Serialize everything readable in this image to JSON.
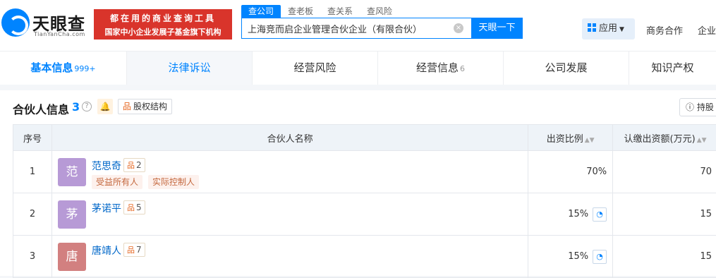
{
  "header": {
    "logo_text": "天眼查",
    "logo_sub": "TianYanCha.com",
    "promo_line1": "都在用的商业查询工具",
    "promo_line2": "国家中小企业发展子基金旗下机构",
    "search_tabs": [
      "查公司",
      "查老板",
      "查关系",
      "查风险"
    ],
    "search_value": "上海竞而启企业管理合伙企业（有限合伙）",
    "search_button": "天眼一下",
    "apps_label": "应用",
    "nav_links": [
      "商务合作",
      "企业"
    ]
  },
  "tabs": [
    {
      "label": "基本信息",
      "count": "999+"
    },
    {
      "label": "法律诉讼",
      "count": ""
    },
    {
      "label": "经营风险",
      "count": ""
    },
    {
      "label": "经营信息",
      "count": "6"
    },
    {
      "label": "公司发展",
      "count": ""
    },
    {
      "label": "知识产权",
      "count": ""
    }
  ],
  "section": {
    "title": "合伙人信息",
    "count": "3",
    "equity_label": "股权结构",
    "hold_label": "持股"
  },
  "table": {
    "headers": [
      "序号",
      "合伙人名称",
      "出资比例",
      "认缴出资额(万元)"
    ],
    "rows": [
      {
        "no": "1",
        "avatar": "范",
        "avatar_color": "#b79ad6",
        "name": "范思奇",
        "relations": "2",
        "tags": [
          "受益所有人",
          "实际控制人"
        ],
        "ratio": "70%",
        "amount": "70",
        "pie": false
      },
      {
        "no": "2",
        "avatar": "茅",
        "avatar_color": "#b79ad6",
        "name": "茅诺平",
        "relations": "5",
        "tags": [],
        "ratio": "15%",
        "amount": "15",
        "pie": true
      },
      {
        "no": "3",
        "avatar": "唐",
        "avatar_color": "#d28080",
        "name": "唐靖人",
        "relations": "7",
        "tags": [],
        "ratio": "15%",
        "amount": "15",
        "pie": true
      }
    ]
  }
}
